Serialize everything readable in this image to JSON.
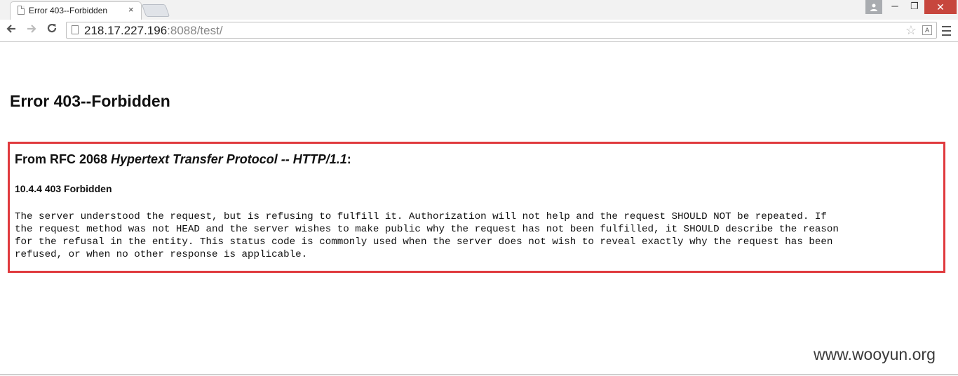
{
  "browser": {
    "tab_title": "Error 403--Forbidden",
    "tab_close": "×",
    "url_host": "218.17.227.196",
    "url_rest": ":8088/test/",
    "window_controls": {
      "minimize": "─",
      "maximize": "❐",
      "close": "✕"
    },
    "icons": [
      "page-icon",
      "back-arrow-icon",
      "forward-arrow-icon",
      "reload-icon",
      "star-icon",
      "extension-icon",
      "menu-icon",
      "profile-icon"
    ]
  },
  "page": {
    "title": "Error 403--Forbidden",
    "rfc_heading_prefix": "From RFC 2068 ",
    "rfc_heading_italic": "Hypertext Transfer Protocol -- HTTP/1.1",
    "rfc_heading_suffix": ":",
    "section_title": "10.4.4 403 Forbidden",
    "body_lines": [
      "The server understood the request, but is refusing to fulfill it. Authorization will not help and the request SHOULD NOT be repeated. If",
      "the request method was not HEAD and the server wishes to make public why the request has not been fulfilled, it SHOULD describe the reason",
      "for the refusal in the entity. This status code is commonly used when the server does not wish to reveal exactly why the request has been",
      "refused, or when no other response is applicable."
    ],
    "highlight_color": "#e03a3e"
  },
  "watermark": "www.wooyun.org"
}
